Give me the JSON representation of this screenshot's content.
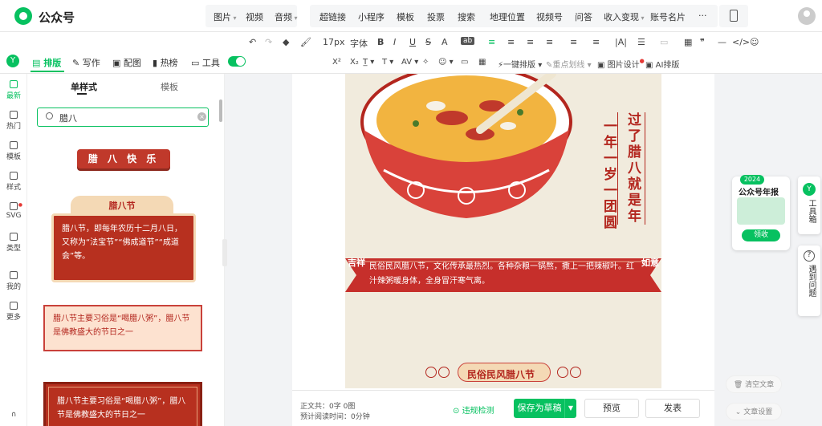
{
  "app": {
    "title": "公众号"
  },
  "top_menu": {
    "group1": [
      "图片",
      "视频",
      "音频"
    ],
    "group2": [
      "超链接",
      "小程序",
      "模板",
      "投票",
      "搜索",
      "地理位置",
      "视频号",
      "问答",
      "收入变现",
      "账号名片",
      "···"
    ]
  },
  "toolbar": {
    "row1": {
      "font_size": "17px",
      "font_family": "字体"
    },
    "row2": {
      "one_click": "一键排版",
      "highlight": "重点划线",
      "image_design": "图片设计",
      "ai_layout": "AI排版"
    }
  },
  "left_tabs": {
    "layout": "排版",
    "write": "写作",
    "image": "配图",
    "hot": "热榜",
    "tools": "工具"
  },
  "rail": [
    {
      "label": "最新"
    },
    {
      "label": "热门"
    },
    {
      "label": "模板"
    },
    {
      "label": "样式"
    },
    {
      "label": "SVG"
    },
    {
      "label": "类型"
    },
    {
      "label": "我的"
    },
    {
      "label": "更多"
    }
  ],
  "panel": {
    "tabs": {
      "single": "单样式",
      "template": "模板"
    },
    "search": {
      "value": "腊八"
    },
    "cards": {
      "c1": "腊 八 快 乐",
      "c2_title": "腊八节",
      "c2_body": "腊八节，即每年农历十二月八日，又称为“法宝节”“佛成道节”“成道会”等。",
      "c3_body": "腊八节主要习俗是“喝腊八粥”，腊八节是佛教盛大的节日之一",
      "c4_body": "腊八节主要习俗是“喝腊八粥”，腊八节是佛教盛大的节日之一"
    }
  },
  "article": {
    "vertical1": "过了腊八就是年",
    "vertical2": "一年一岁一团圆",
    "ribbon_text": "民俗民风腊八节，文化传承最热烈。各种杂粮一锅熬，撒上一把辣椒叶。红汁辣粥暖身体，全身冒汗寒气离。",
    "seal_left": "吉祥",
    "seal_right": "如意",
    "footer_title": "民俗民风腊八节"
  },
  "bottom_bar": {
    "body_stats": "正文共：0字 0图",
    "read_time": "预计阅读时间：0分钟",
    "check": "违规检测",
    "save": "保存为草稿",
    "preview": "预览",
    "publish": "发表"
  },
  "right_side": {
    "promo_year": "2024",
    "promo_title": "公众号年报",
    "promo_btn": "领收",
    "tools": "工具箱",
    "help": "遇到问题",
    "clear": "清空文章",
    "settings": "文章设置"
  },
  "colors": {
    "accent": "#07c160",
    "festive_red": "#b3261e",
    "cream": "#f4d9b5"
  }
}
